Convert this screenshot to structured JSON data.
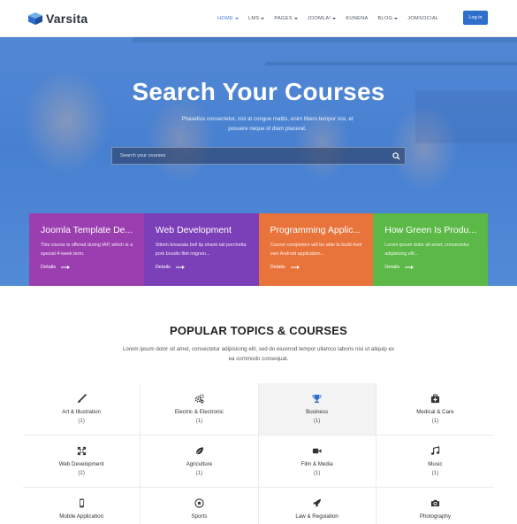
{
  "brand": {
    "name": "Varsita"
  },
  "nav": {
    "items": [
      {
        "label": "HOME",
        "dropdown": true,
        "active": true
      },
      {
        "label": "LMS",
        "dropdown": true
      },
      {
        "label": "PAGES",
        "dropdown": true
      },
      {
        "label": "JOOMLA!",
        "dropdown": true
      },
      {
        "label": "KUNENA",
        "dropdown": false
      },
      {
        "label": "BLOG",
        "dropdown": true
      },
      {
        "label": "JOMSOCIAL",
        "dropdown": false
      }
    ],
    "login_label": "Log in"
  },
  "hero": {
    "title": "Search Your Courses",
    "subtitle": "Phasellus consectetur, nisl at congue mattis, enim libero tempor nisi, et posuere neque id diam placerat.",
    "search_placeholder": "Search your courses"
  },
  "cards": [
    {
      "title": "Joomla Template De...",
      "desc": "This course is offered during IAP, which is a special 4-week term.",
      "link": "Details",
      "color": "#9b3fb0"
    },
    {
      "title": "Web Development",
      "desc": "Sittoin breasata bell tip shank tail porchetta pork boudin filet mignon...",
      "link": "Details",
      "color": "#7b3fb8"
    },
    {
      "title": "Programming Applic...",
      "desc": "Course completers will be able to build their own Android application...",
      "link": "Details",
      "color": "#e8743b"
    },
    {
      "title": "How Green Is Produ...",
      "desc": "Lorem ipsum dolor sit amet, consectetur adipisicing elit...",
      "link": "Details",
      "color": "#5cb847"
    }
  ],
  "topics": {
    "title": "POPULAR TOPICS & COURSES",
    "subtitle": "Lorem ipsum dolor sit amet, consectetur adipisicing elit, sed do eiusmod tempor ullamco laboris nisi ut aliquip ex ea commodo consequat.",
    "items": [
      {
        "label": "Art & Illustration",
        "count": "(1)",
        "icon": "brush-icon"
      },
      {
        "label": "Electric & Electronic",
        "count": "(1)",
        "icon": "cogs-icon"
      },
      {
        "label": "Business",
        "count": "(1)",
        "icon": "trophy-icon",
        "highlight": true
      },
      {
        "label": "Medical & Care",
        "count": "(1)",
        "icon": "medkit-icon"
      },
      {
        "label": "Web Development",
        "count": "(2)",
        "icon": "expand-icon"
      },
      {
        "label": "Agriculture",
        "count": "(1)",
        "icon": "leaf-icon"
      },
      {
        "label": "Film & Media",
        "count": "(1)",
        "icon": "video-camera-icon"
      },
      {
        "label": "Music",
        "count": "(1)",
        "icon": "music-icon"
      },
      {
        "label": "Mobile Application",
        "count": "",
        "icon": "mobile-icon"
      },
      {
        "label": "Sports",
        "count": "",
        "icon": "soccer-ball-icon"
      },
      {
        "label": "Law & Regulation",
        "count": "",
        "icon": "rocket-icon"
      },
      {
        "label": "Photography",
        "count": "",
        "icon": "camera-icon"
      }
    ]
  },
  "colors": {
    "accent": "#2e6fcb",
    "hero_overlay": "#4f86d2",
    "text_dark": "#222222"
  }
}
